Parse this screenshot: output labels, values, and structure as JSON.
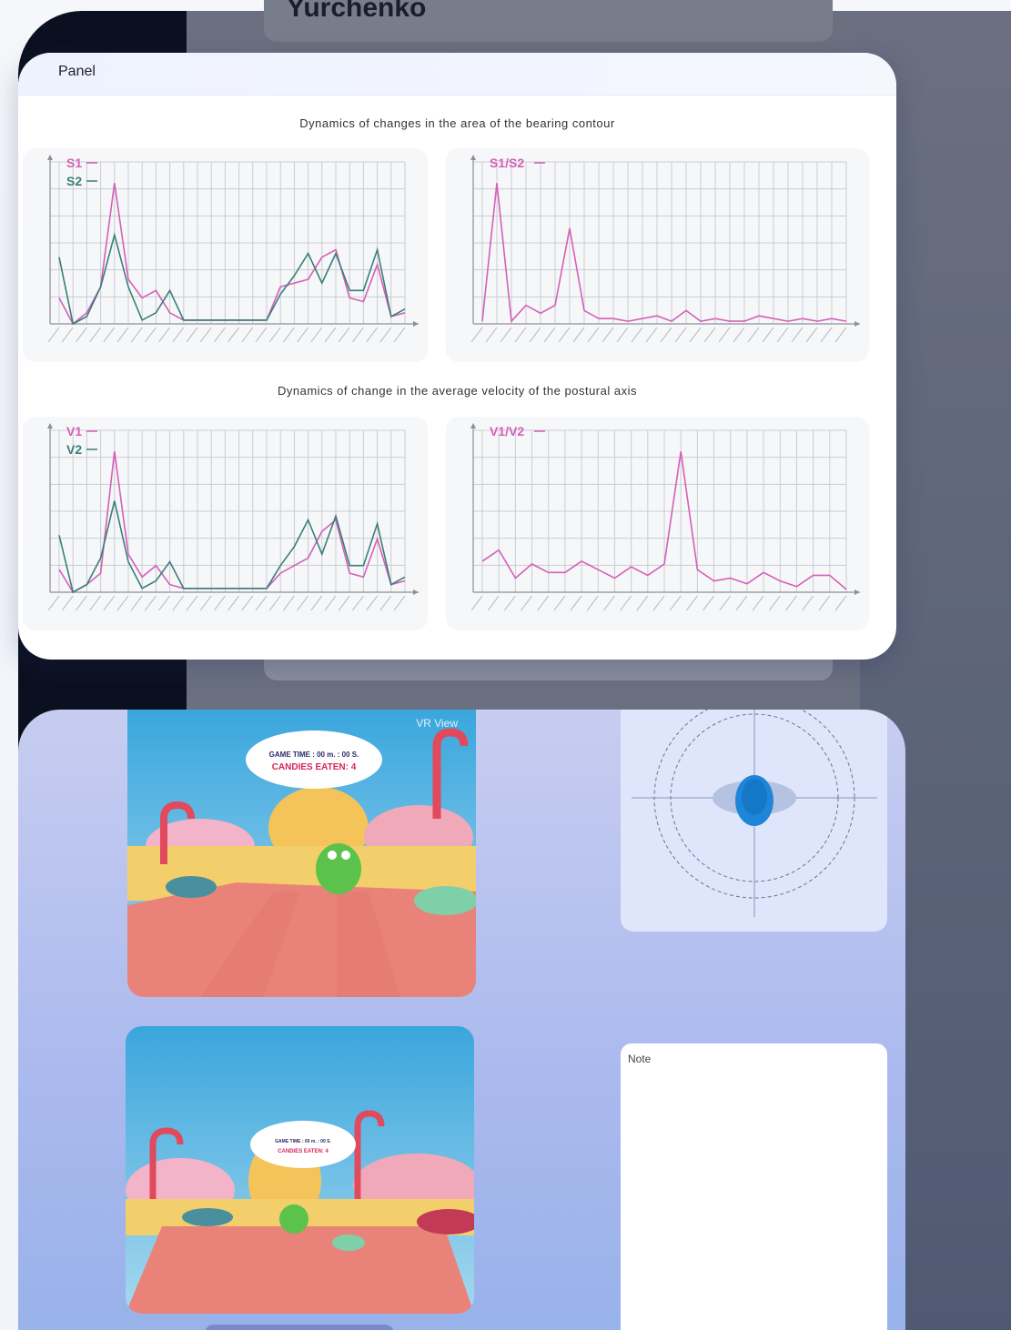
{
  "background": {
    "user_name": "Yurchenko"
  },
  "analytics_panel": {
    "title": "Panel",
    "section1_title": "Dynamics of changes in the area of the bearing contour",
    "section2_title": "Dynamics of change in the average velocity of the postural axis"
  },
  "chart_data": [
    {
      "type": "line",
      "title": "",
      "series": [
        {
          "name": "S1",
          "color": "#d65fb8",
          "values": [
            7,
            0,
            3,
            10,
            38,
            12,
            7,
            9,
            3,
            1,
            1,
            1,
            1,
            1,
            1,
            1,
            10,
            11,
            12,
            18,
            20,
            7,
            6,
            16,
            2,
            3
          ]
        },
        {
          "name": "S2",
          "color": "#3a7f78",
          "values": [
            18,
            0,
            2,
            10,
            24,
            10,
            1,
            3,
            9,
            1,
            1,
            1,
            1,
            1,
            1,
            1,
            8,
            13,
            19,
            11,
            19,
            9,
            9,
            20,
            2,
            4
          ]
        }
      ]
    },
    {
      "type": "line",
      "title": "",
      "series": [
        {
          "name": "S1/S2",
          "color": "#d65fb8",
          "values": [
            1,
            53,
            1,
            7,
            4,
            7,
            36,
            5,
            2,
            2,
            1,
            2,
            3,
            1,
            5,
            1,
            2,
            1,
            1,
            3,
            2,
            1,
            2,
            1,
            2,
            1
          ]
        }
      ]
    },
    {
      "type": "line",
      "title": "",
      "series": [
        {
          "name": "V1",
          "color": "#d65fb8",
          "values": [
            6,
            0,
            2,
            5,
            37,
            10,
            4,
            7,
            2,
            1,
            1,
            1,
            1,
            1,
            1,
            1,
            5,
            7,
            9,
            16,
            19,
            5,
            4,
            14,
            2,
            3
          ]
        },
        {
          "name": "V2",
          "color": "#3a7f78",
          "values": [
            15,
            0,
            2,
            9,
            24,
            8,
            1,
            3,
            8,
            1,
            1,
            1,
            1,
            1,
            1,
            1,
            7,
            12,
            19,
            10,
            20,
            7,
            7,
            18,
            2,
            4
          ]
        }
      ]
    },
    {
      "type": "line",
      "title": "",
      "series": [
        {
          "name": "V1/V2",
          "color": "#d65fb8",
          "values": [
            11,
            15,
            5,
            10,
            7,
            7,
            11,
            8,
            5,
            9,
            6,
            10,
            50,
            8,
            4,
            5,
            3,
            7,
            4,
            2,
            6,
            6,
            1
          ]
        }
      ]
    }
  ],
  "vr": {
    "label": "VR View",
    "hud_line1": "GAME TIME : 00 m. : 00 S.",
    "hud_line2": "CANDIES EATEN: 4"
  },
  "note": {
    "label": "Note"
  }
}
